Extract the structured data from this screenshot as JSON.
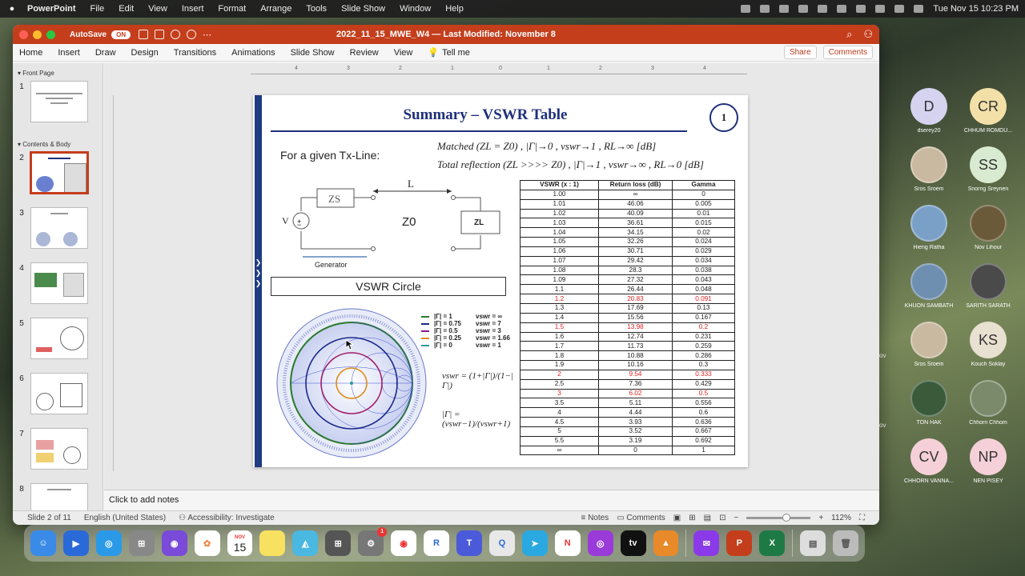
{
  "menubar": {
    "app": "PowerPoint",
    "items": [
      "File",
      "Edit",
      "View",
      "Insert",
      "Format",
      "Arrange",
      "Tools",
      "Slide Show",
      "Window",
      "Help"
    ],
    "clock": "Tue Nov 15  10:23 PM"
  },
  "window": {
    "autosave": "AutoSave",
    "autosave_state": "ON",
    "title": "2022_11_15_MWE_W4 — Last Modified: November 8"
  },
  "ribbon": {
    "tabs": [
      "Home",
      "Insert",
      "Draw",
      "Design",
      "Transitions",
      "Animations",
      "Slide Show",
      "Review",
      "View"
    ],
    "tell_me": "Tell me",
    "share": "Share",
    "comments": "Comments"
  },
  "sidebar": {
    "section1": "Front Page",
    "section2": "Contents & Body",
    "slides": [
      "1",
      "2",
      "3",
      "4",
      "5",
      "6",
      "7",
      "8"
    ],
    "selected": "2"
  },
  "ruler": {
    "ticks": [
      "4",
      "3",
      "2",
      "1",
      "0",
      "1",
      "2",
      "3",
      "4"
    ]
  },
  "slide": {
    "title": "Summary – VSWR Table",
    "number": "1",
    "given": "For a given Tx-Line:",
    "matched": "Matched (Z",
    "eq1": "Matched (ZL = Z0) ,   |Γ|→0 ,  vswr→1 ,  RL→∞ [dB]",
    "eq2": "Total reflection (ZL >>>> Z0) ,  |Γ|→1 , vswr→∞ ,  RL→0 [dB]",
    "circuit": {
      "zs": "ZS",
      "zl": "ZL",
      "z0": "Z0",
      "l": "L",
      "v": "V",
      "generator": "Generator"
    },
    "vswr_circle": "VSWR Circle",
    "formula1": "vswr = (1+|Γ|)/(1−|Γ|)",
    "formula2": "|Γ| = (vswr−1)/(vswr+1)",
    "legend": [
      {
        "g": "|Γ| = 1",
        "v": "vswr = ∞",
        "color": "#2a7a2a"
      },
      {
        "g": "|Γ| = 0.75",
        "v": "vswr = 7",
        "color": "#1a2a8a"
      },
      {
        "g": "|Γ| = 0.5",
        "v": "vswr = 3",
        "color": "#8a1a8a"
      },
      {
        "g": "|Γ| = 0.25",
        "v": "vswr = 1.66",
        "color": "#e08a1a"
      },
      {
        "g": "|Γ| = 0",
        "v": "vswr = 1",
        "color": "#2a9a9a"
      }
    ],
    "table": {
      "headers": [
        "VSWR  (x : 1)",
        "Return loss (dB)",
        "Gamma"
      ],
      "rows": [
        [
          "1.00",
          "∞",
          "0",
          false
        ],
        [
          "1.01",
          "46.06",
          "0.005",
          false
        ],
        [
          "1.02",
          "40.09",
          "0.01",
          false
        ],
        [
          "1.03",
          "36.61",
          "0.015",
          false
        ],
        [
          "1.04",
          "34.15",
          "0.02",
          false
        ],
        [
          "1.05",
          "32.26",
          "0.024",
          false
        ],
        [
          "1.06",
          "30.71",
          "0.029",
          false
        ],
        [
          "1.07",
          "29.42",
          "0.034",
          false
        ],
        [
          "1.08",
          "28.3",
          "0.038",
          false
        ],
        [
          "1.09",
          "27.32",
          "0.043",
          false
        ],
        [
          "1.1",
          "26.44",
          "0.048",
          false
        ],
        [
          "1.2",
          "20.83",
          "0.091",
          true
        ],
        [
          "1.3",
          "17.69",
          "0.13",
          false
        ],
        [
          "1.4",
          "15.56",
          "0.167",
          false
        ],
        [
          "1.5",
          "13.98",
          "0.2",
          true
        ],
        [
          "1.6",
          "12.74",
          "0.231",
          false
        ],
        [
          "1.7",
          "11.73",
          "0.259",
          false
        ],
        [
          "1.8",
          "10.88",
          "0.286",
          false
        ],
        [
          "1.9",
          "10.16",
          "0.3",
          false
        ],
        [
          "2",
          "9.54",
          "0.333",
          true
        ],
        [
          "2.5",
          "7.36",
          "0.429",
          false
        ],
        [
          "3",
          "6.02",
          "0.5",
          true
        ],
        [
          "3.5",
          "5.11",
          "0.556",
          false
        ],
        [
          "4",
          "4.44",
          "0.6",
          false
        ],
        [
          "4.5",
          "3.93",
          "0.636",
          false
        ],
        [
          "5",
          "3.52",
          "0.667",
          false
        ],
        [
          "5.5",
          "3.19",
          "0.692",
          false
        ],
        [
          "∞",
          "0",
          "1",
          false
        ]
      ]
    }
  },
  "notes": "Click to add notes",
  "status": {
    "slide": "Slide 2 of 11",
    "lang": "English (United States)",
    "access": "Accessibility: Investigate",
    "notes": "Notes",
    "comments": "Comments",
    "zoom": "112%"
  },
  "participants": [
    {
      "init": "D",
      "name": "dserey20",
      "bg": "#d6d3f0",
      "photo": false
    },
    {
      "init": "CR",
      "name": "CHHUM ROMDU...",
      "bg": "#f3e0a8",
      "photo": false
    },
    {
      "init": "",
      "name": "Sros Sroem",
      "bg": "#c9b9a0",
      "photo": true
    },
    {
      "init": "SS",
      "name": "Snorng Sreynen",
      "bg": "#d8ead0",
      "photo": false
    },
    {
      "init": "",
      "name": "Hieng Ratha",
      "bg": "#7aa0c8",
      "photo": true
    },
    {
      "init": "",
      "name": "Nov Lihour",
      "bg": "#6a5a3a",
      "photo": true
    },
    {
      "init": "",
      "name": "KHUON SAMBATH",
      "bg": "#6f8fb0",
      "photo": true
    },
    {
      "init": "",
      "name": "SARITH SARATH",
      "bg": "#4a4a4a",
      "photo": true
    },
    {
      "init": "",
      "name": "Sros Sroem",
      "bg": "#c9b9a0",
      "photo": true
    },
    {
      "init": "KS",
      "name": "Kouch Soklay",
      "bg": "#e8e0d0",
      "photo": false
    },
    {
      "init": "",
      "name": "TON HAK",
      "bg": "#3a5a3a",
      "photo": true
    },
    {
      "init": "",
      "name": "Chhorn Chhom",
      "bg": "#7a8a6a",
      "photo": true
    },
    {
      "init": "CV",
      "name": "CHHORN VANNA...",
      "bg": "#f5d0d8",
      "photo": false
    },
    {
      "init": "NP",
      "name": "NEN PISEY",
      "bg": "#f5d0d8",
      "photo": false
    }
  ],
  "dock": {
    "calendar_month": "NOV",
    "calendar_day": "15",
    "badge": "1"
  },
  "overlay_text": "ov"
}
